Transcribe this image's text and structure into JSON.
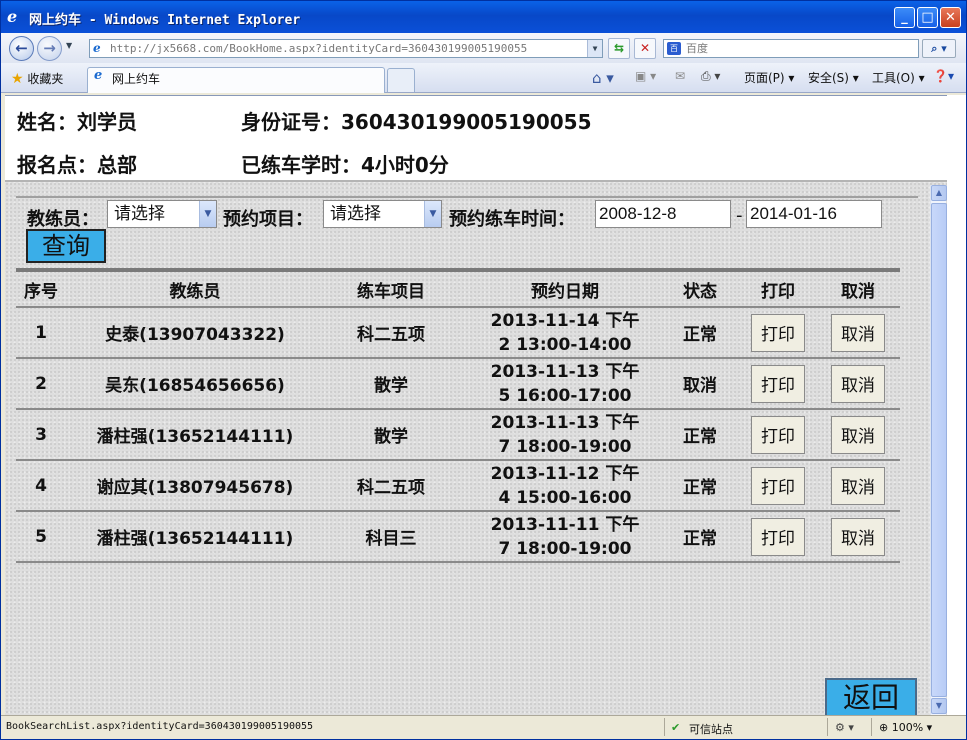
{
  "window": {
    "title": "网上约车 - Windows Internet Explorer",
    "address": "http://jx5668.com/BookHome.aspx?identityCard=360430199005190055",
    "search_placeholder": "百度",
    "favorites_label": "收藏夹",
    "tab_title": "网上约车",
    "menu_page": "页面(P)",
    "menu_safety": "安全(S)",
    "menu_tools": "工具(O)"
  },
  "header": {
    "name_label": "姓名：刘学员",
    "id_label": "身份证号：360430199005190055",
    "site_label": "报名点：总部",
    "hours_label": "已练车学时：4小时0分"
  },
  "filters": {
    "coach_label": "教练员：",
    "coach_value": "请选择",
    "item_label": "预约项目：",
    "item_value": "请选择",
    "time_label": "预约练车时间：",
    "date_from": "2008-12-8",
    "date_sep": "-",
    "date_to": "2014-01-16",
    "query_button": "查询"
  },
  "table": {
    "headers": [
      "序号",
      "教练员",
      "练车项目",
      "预约日期",
      "状态",
      "打印",
      "取消"
    ],
    "rows": [
      {
        "no": "1",
        "coach": "史泰(13907043322)",
        "item": "科二五项",
        "date1": "2013-11-14 下午",
        "date2": "2 13:00-14:00",
        "status": "正常",
        "print": "打印",
        "cancel": "取消"
      },
      {
        "no": "2",
        "coach": "吴东(16854656656)",
        "item": "散学",
        "date1": "2013-11-13 下午",
        "date2": "5 16:00-17:00",
        "status": "取消",
        "print": "打印",
        "cancel": "取消"
      },
      {
        "no": "3",
        "coach": "潘柱强(13652144111)",
        "item": "散学",
        "date1": "2013-11-13 下午",
        "date2": "7 18:00-19:00",
        "status": "正常",
        "print": "打印",
        "cancel": "取消"
      },
      {
        "no": "4",
        "coach": "谢应其(13807945678)",
        "item": "科二五项",
        "date1": "2013-11-12 下午",
        "date2": "4 15:00-16:00",
        "status": "正常",
        "print": "打印",
        "cancel": "取消"
      },
      {
        "no": "5",
        "coach": "潘柱强(13652144111)",
        "item": "科目三",
        "date1": "2013-11-11 下午",
        "date2": "7 18:00-19:00",
        "status": "正常",
        "print": "打印",
        "cancel": "取消"
      }
    ]
  },
  "back_button": "返回",
  "statusbar": {
    "url": "BookSearchList.aspx?identityCard=360430199005190055",
    "zone": "可信站点",
    "zoom": "100%"
  }
}
